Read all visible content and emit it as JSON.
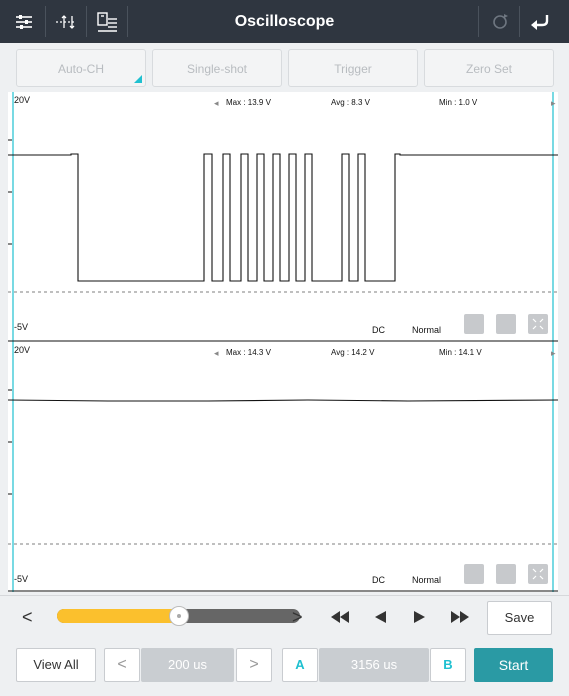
{
  "app": {
    "title": "Oscilloscope"
  },
  "toolbar_icons": [
    "sliders-icon",
    "measure-icon",
    "save-file-icon",
    "refresh-icon",
    "back-icon"
  ],
  "top_buttons": [
    {
      "label": "Auto-CH"
    },
    {
      "label": "Single-shot"
    },
    {
      "label": "Trigger"
    },
    {
      "label": "Zero Set"
    }
  ],
  "channel1": {
    "top_label": "20V",
    "bottom_label": "-5V",
    "max": "Max : 13.9 V",
    "avg": "Avg : 8.3 V",
    "min": "Min : 1.0 V",
    "coupling": "DC",
    "mode": "Normal"
  },
  "channel2": {
    "top_label": "20V",
    "bottom_label": "-5V",
    "max": "Max : 14.3 V",
    "avg": "Avg : 14.2 V",
    "min": "Min : 14.1 V",
    "coupling": "DC",
    "mode": "Normal"
  },
  "controls": {
    "slider_position": 0.5,
    "prev_label": "<",
    "next_label": ">",
    "save_label": "Save"
  },
  "bottom": {
    "view_all_label": "View All",
    "timebase_prev": "<",
    "timebase_value": "200 us",
    "timebase_next": ">",
    "cursor_a_label": "A",
    "cursor_delta": "3156 us",
    "cursor_b_label": "B",
    "start_label": "Start"
  },
  "colors": {
    "titlebar": "#2f3640",
    "accent_cyan": "#1fc0d0",
    "slider_yellow": "#fbc02d",
    "start_teal": "#2a9aa4"
  }
}
